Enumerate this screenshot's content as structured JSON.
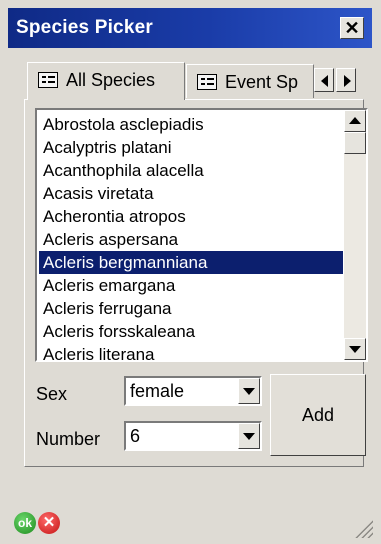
{
  "window": {
    "title": "Species Picker",
    "close_glyph": "✕"
  },
  "tabs": [
    {
      "label": "All Species",
      "icon": "list-icon",
      "active": true
    },
    {
      "label": "Event Sp",
      "icon": "list-icon",
      "active": false
    }
  ],
  "species_list": {
    "items": [
      "Abrostola asclepiadis",
      "Acalyptris platani",
      "Acanthophila alacella",
      "Acasis viretata",
      "Acherontia atropos",
      "Acleris aspersana",
      "Acleris bergmanniana",
      "Acleris emargana",
      "Acleris ferrugana",
      "Acleris forsskaleana",
      "Acleris literana"
    ],
    "selected": "Acleris bergmanniana"
  },
  "form": {
    "sex_label": "Sex",
    "sex_value": "female",
    "number_label": "Number",
    "number_value": "6",
    "add_label": "Add"
  },
  "footer": {
    "ok_label": "ok",
    "cancel_glyph": "✕"
  },
  "colors": {
    "titlebar": "#0f2a86",
    "selection": "#0c1f6e",
    "ok": "#1d8c1d",
    "cancel": "#c31212"
  }
}
